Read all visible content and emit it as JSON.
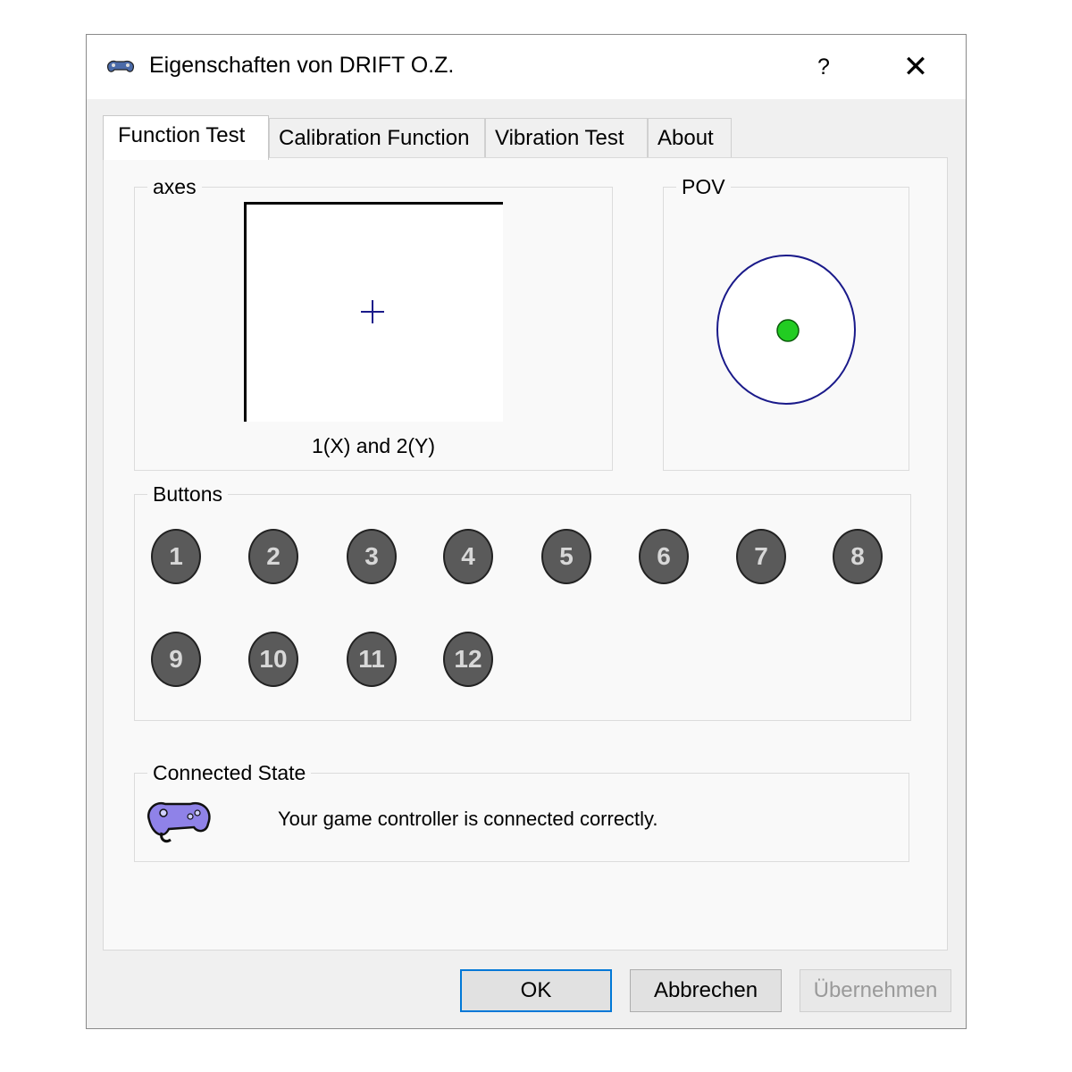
{
  "window": {
    "title": "Eigenschaften von DRIFT O.Z.",
    "help_label": "?",
    "close_label": "✕"
  },
  "tabs": [
    {
      "label": "Function Test",
      "active": true
    },
    {
      "label": "Calibration Function",
      "active": false
    },
    {
      "label": "Vibration Test",
      "active": false
    },
    {
      "label": "About",
      "active": false
    }
  ],
  "axes": {
    "group_label": "axes",
    "caption": "1(X) and 2(Y)"
  },
  "pov": {
    "group_label": "POV",
    "indicator_color": "#22cc22"
  },
  "buttons": {
    "group_label": "Buttons",
    "items": [
      "1",
      "2",
      "3",
      "4",
      "5",
      "6",
      "7",
      "8",
      "9",
      "10",
      "11",
      "12"
    ]
  },
  "connected_state": {
    "group_label": "Connected State",
    "message": "Your game controller is connected correctly."
  },
  "footer": {
    "ok_label": "OK",
    "cancel_label": "Abbrechen",
    "apply_label": "Übernehmen"
  }
}
